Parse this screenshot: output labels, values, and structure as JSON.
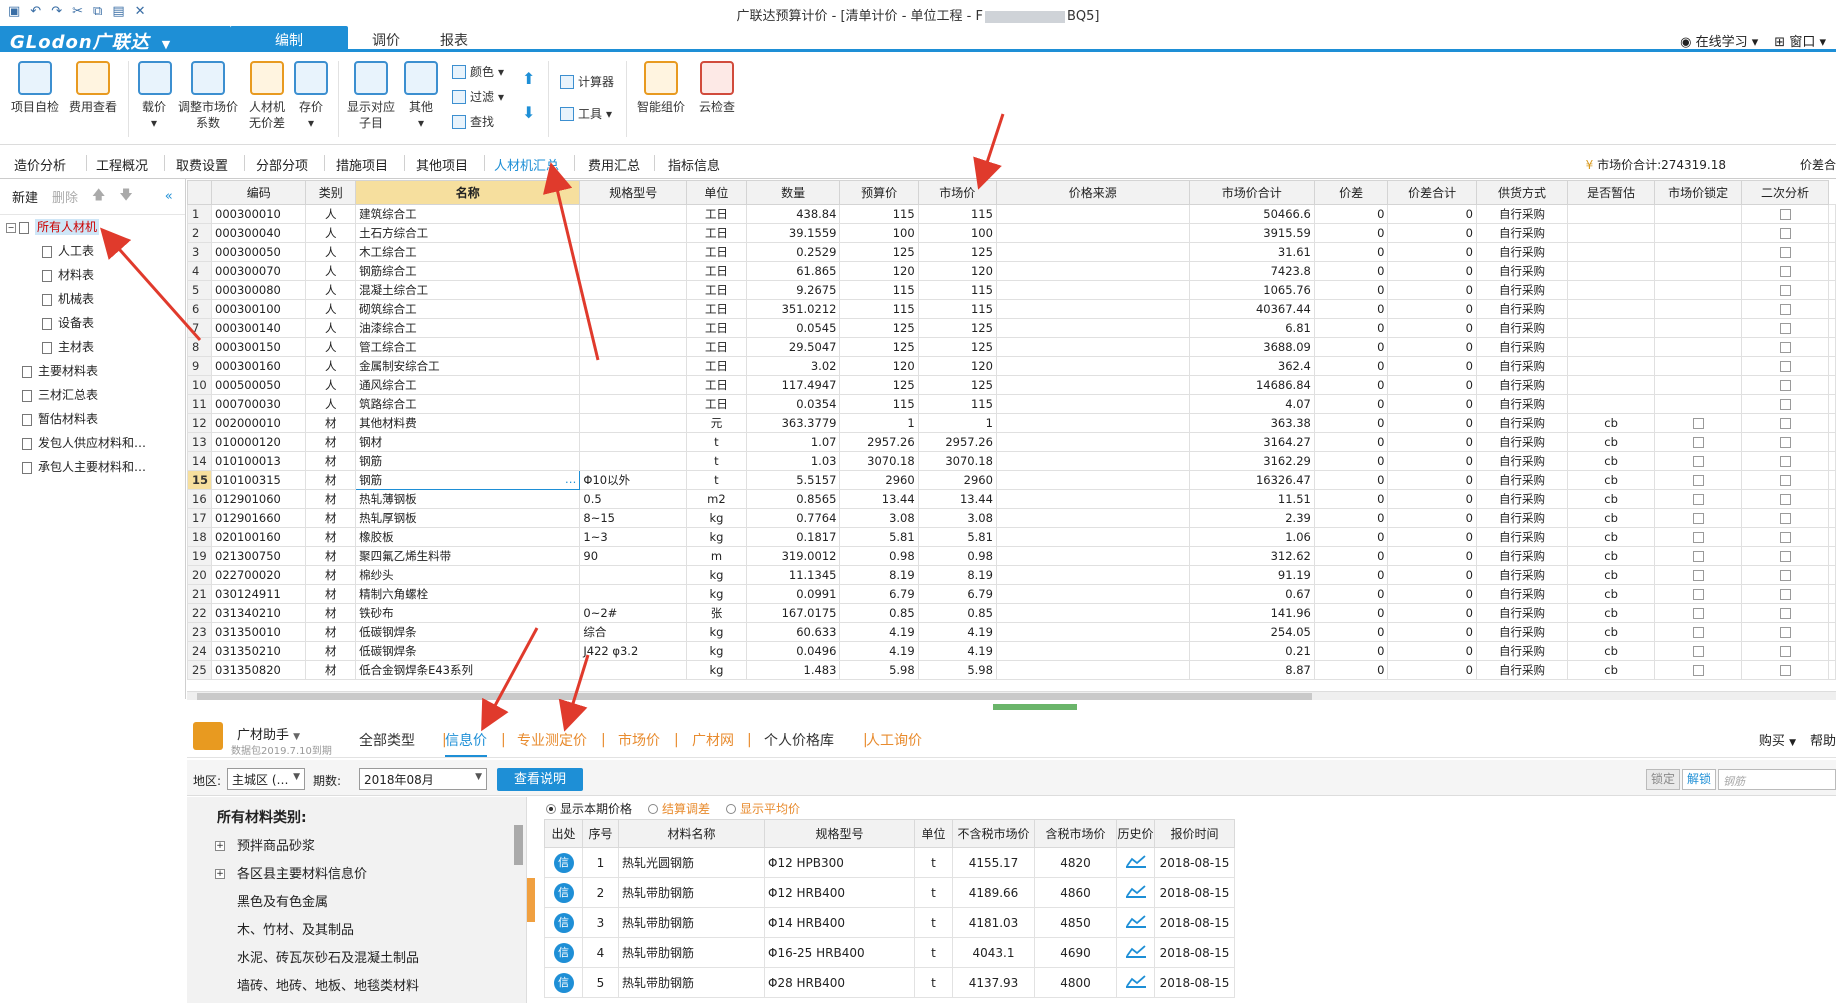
{
  "titlebar": {
    "title_prefix": "广联达预算计价 - [清单计价 - 单位工程 - F",
    "title_suffix": "BQ5]"
  },
  "menubar": {
    "logo": "GLodon广联达",
    "logo_dd": "▼",
    "tabs": [
      "编制",
      "调价",
      "报表"
    ],
    "right": [
      "在线学习",
      "窗口"
    ]
  },
  "ribbon": {
    "large": [
      "项目自检",
      "费用查看",
      "载价",
      "调整市场价系数",
      "人材机无价差",
      "存价",
      "显示对应子目",
      "其他",
      "智能组价",
      "云检查"
    ],
    "small": [
      "颜色",
      "过滤",
      "查找",
      "计算器",
      "工具"
    ]
  },
  "subtabs": [
    "造价分析",
    "工程概况",
    "取费设置",
    "分部分项",
    "措施项目",
    "其他项目",
    "人材机汇总",
    "费用汇总",
    "指标信息"
  ],
  "market_total": "市场价合计:274319.18",
  "price_diff_label": "价差合",
  "left": {
    "new": "新建",
    "del": "删除",
    "tree": [
      "所有人材机",
      "人工表",
      "材料表",
      "机械表",
      "设备表",
      "主材表",
      "主要材料表",
      "三材汇总表",
      "暂估材料表",
      "发包人供应材料和…",
      "承包人主要材料和…"
    ]
  },
  "grid": {
    "headers": [
      "编码",
      "类别",
      "名称",
      "规格型号",
      "单位",
      "数量",
      "预算价",
      "市场价",
      "价格来源",
      "市场价合计",
      "价差",
      "价差合计",
      "供货方式",
      "是否暂估",
      "市场价锁定",
      "二次分析"
    ],
    "rows": [
      [
        "1",
        "000300010",
        "人",
        "建筑综合工",
        "",
        "工日",
        "438.84",
        "115",
        "115",
        "",
        "50466.6",
        "0",
        "0",
        "自行采购",
        "",
        true
      ],
      [
        "2",
        "000300040",
        "人",
        "土石方综合工",
        "",
        "工日",
        "39.1559",
        "100",
        "100",
        "",
        "3915.59",
        "0",
        "0",
        "自行采购",
        "",
        true
      ],
      [
        "3",
        "000300050",
        "人",
        "木工综合工",
        "",
        "工日",
        "0.2529",
        "125",
        "125",
        "",
        "31.61",
        "0",
        "0",
        "自行采购",
        "",
        true
      ],
      [
        "4",
        "000300070",
        "人",
        "钢筋综合工",
        "",
        "工日",
        "61.865",
        "120",
        "120",
        "",
        "7423.8",
        "0",
        "0",
        "自行采购",
        "",
        true
      ],
      [
        "5",
        "000300080",
        "人",
        "混凝土综合工",
        "",
        "工日",
        "9.2675",
        "115",
        "115",
        "",
        "1065.76",
        "0",
        "0",
        "自行采购",
        "",
        true
      ],
      [
        "6",
        "000300100",
        "人",
        "砌筑综合工",
        "",
        "工日",
        "351.0212",
        "115",
        "115",
        "",
        "40367.44",
        "0",
        "0",
        "自行采购",
        "",
        true
      ],
      [
        "7",
        "000300140",
        "人",
        "油漆综合工",
        "",
        "工日",
        "0.0545",
        "125",
        "125",
        "",
        "6.81",
        "0",
        "0",
        "自行采购",
        "",
        true
      ],
      [
        "8",
        "000300150",
        "人",
        "管工综合工",
        "",
        "工日",
        "29.5047",
        "125",
        "125",
        "",
        "3688.09",
        "0",
        "0",
        "自行采购",
        "",
        true
      ],
      [
        "9",
        "000300160",
        "人",
        "金属制安综合工",
        "",
        "工日",
        "3.02",
        "120",
        "120",
        "",
        "362.4",
        "0",
        "0",
        "自行采购",
        "",
        true
      ],
      [
        "10",
        "000500050",
        "人",
        "通风综合工",
        "",
        "工日",
        "117.4947",
        "125",
        "125",
        "",
        "14686.84",
        "0",
        "0",
        "自行采购",
        "",
        true
      ],
      [
        "11",
        "000700030",
        "人",
        "筑路综合工",
        "",
        "工日",
        "0.0354",
        "115",
        "115",
        "",
        "4.07",
        "0",
        "0",
        "自行采购",
        "",
        true
      ],
      [
        "12",
        "002000010",
        "材",
        "其他材料费",
        "",
        "元",
        "363.3779",
        "1",
        "1",
        "",
        "363.38",
        "0",
        "0",
        "自行采购",
        "cb",
        true
      ],
      [
        "13",
        "010000120",
        "材",
        "钢材",
        "",
        "t",
        "1.07",
        "2957.26",
        "2957.26",
        "",
        "3164.27",
        "0",
        "0",
        "自行采购",
        "cb",
        true
      ],
      [
        "14",
        "010100013",
        "材",
        "钢筋",
        "",
        "t",
        "1.03",
        "3070.18",
        "3070.18",
        "",
        "3162.29",
        "0",
        "0",
        "自行采购",
        "cb",
        true
      ],
      [
        "15",
        "010100315",
        "材",
        "钢筋",
        "Φ10以外",
        "t",
        "5.5157",
        "2960",
        "2960",
        "",
        "16326.47",
        "0",
        "0",
        "自行采购",
        "cb",
        true
      ],
      [
        "16",
        "012901060",
        "材",
        "热轧薄钢板",
        "0.5",
        "m2",
        "0.8565",
        "13.44",
        "13.44",
        "",
        "11.51",
        "0",
        "0",
        "自行采购",
        "cb",
        true
      ],
      [
        "17",
        "012901660",
        "材",
        "热轧厚钢板",
        "8~15",
        "kg",
        "0.7764",
        "3.08",
        "3.08",
        "",
        "2.39",
        "0",
        "0",
        "自行采购",
        "cb",
        true
      ],
      [
        "18",
        "020100160",
        "材",
        "橡胶板",
        "1~3",
        "kg",
        "0.1817",
        "5.81",
        "5.81",
        "",
        "1.06",
        "0",
        "0",
        "自行采购",
        "cb",
        true
      ],
      [
        "19",
        "021300750",
        "材",
        "聚四氟乙烯生料带",
        "90",
        "m",
        "319.0012",
        "0.98",
        "0.98",
        "",
        "312.62",
        "0",
        "0",
        "自行采购",
        "cb",
        true
      ],
      [
        "20",
        "022700020",
        "材",
        "棉纱头",
        "",
        "kg",
        "11.1345",
        "8.19",
        "8.19",
        "",
        "91.19",
        "0",
        "0",
        "自行采购",
        "cb",
        true
      ],
      [
        "21",
        "030124911",
        "材",
        "精制六角螺栓",
        "",
        "kg",
        "0.0991",
        "6.79",
        "6.79",
        "",
        "0.67",
        "0",
        "0",
        "自行采购",
        "cb",
        true
      ],
      [
        "22",
        "031340210",
        "材",
        "铁砂布",
        "0~2#",
        "张",
        "167.0175",
        "0.85",
        "0.85",
        "",
        "141.96",
        "0",
        "0",
        "自行采购",
        "cb",
        true
      ],
      [
        "23",
        "031350010",
        "材",
        "低碳钢焊条",
        "综合",
        "kg",
        "60.633",
        "4.19",
        "4.19",
        "",
        "254.05",
        "0",
        "0",
        "自行采购",
        "cb",
        true
      ],
      [
        "24",
        "031350210",
        "材",
        "低碳钢焊条",
        "J422 φ3.2",
        "kg",
        "0.0496",
        "4.19",
        "4.19",
        "",
        "0.21",
        "0",
        "0",
        "自行采购",
        "cb",
        true
      ],
      [
        "25",
        "031350820",
        "材",
        "低合金钢焊条E43系列",
        "",
        "kg",
        "1.483",
        "5.98",
        "5.98",
        "",
        "8.87",
        "0",
        "0",
        "自行采购",
        "cb",
        true
      ]
    ]
  },
  "assist": {
    "name": "广材助手",
    "name_dd": "▼",
    "sub": "数据包2019.7.10到期",
    "tabs": [
      "全部类型",
      "信息价",
      "专业测定价",
      "市场价",
      "广材网",
      "个人价格库",
      "人工询价"
    ],
    "buy": "购买",
    "buy_dd": "▼",
    "help": "帮助"
  },
  "filter": {
    "region_label": "地区:",
    "region": "主城区 (…",
    "period_label": "期数:",
    "period": "2018年08月",
    "explain": "查看说明",
    "lock": "锁定",
    "unlock": "解锁",
    "search_ph": "钢筋"
  },
  "categories": {
    "title": "所有材料类别:",
    "items": [
      "预拌商品砂浆",
      "各区县主要材料信息价",
      "黑色及有色金属",
      "木、竹材、及其制品",
      "水泥、砖瓦灰砂石及混凝土制品",
      "墙砖、地砖、地板、地毯类材料"
    ]
  },
  "price": {
    "radios": [
      "显示本期价格",
      "结算调差",
      "显示平均价"
    ],
    "headers": [
      "出处",
      "序号",
      "材料名称",
      "规格型号",
      "单位",
      "不含税市场价",
      "含税市场价",
      "历史价",
      "报价时间"
    ],
    "rows": [
      [
        "信",
        "1",
        "热轧光圆钢筋",
        "Φ12 HPB300",
        "t",
        "4155.17",
        "4820",
        "",
        "2018-08-15"
      ],
      [
        "信",
        "2",
        "热轧带肋钢筋",
        "Φ12 HRB400",
        "t",
        "4189.66",
        "4860",
        "",
        "2018-08-15"
      ],
      [
        "信",
        "3",
        "热轧带肋钢筋",
        "Φ14 HRB400",
        "t",
        "4181.03",
        "4850",
        "",
        "2018-08-15"
      ],
      [
        "信",
        "4",
        "热轧带肋钢筋",
        "Φ16-25 HRB400",
        "t",
        "4043.1",
        "4690",
        "",
        "2018-08-15"
      ],
      [
        "信",
        "5",
        "热轧带肋钢筋",
        "Φ28 HRB400",
        "t",
        "4137.93",
        "4800",
        "",
        "2018-08-15"
      ]
    ]
  },
  "colors": {
    "accent": "#1e8fd6",
    "header_highlight": "#f6df9e",
    "orange": "#e88b2e",
    "arrow": "#e03a2c"
  }
}
